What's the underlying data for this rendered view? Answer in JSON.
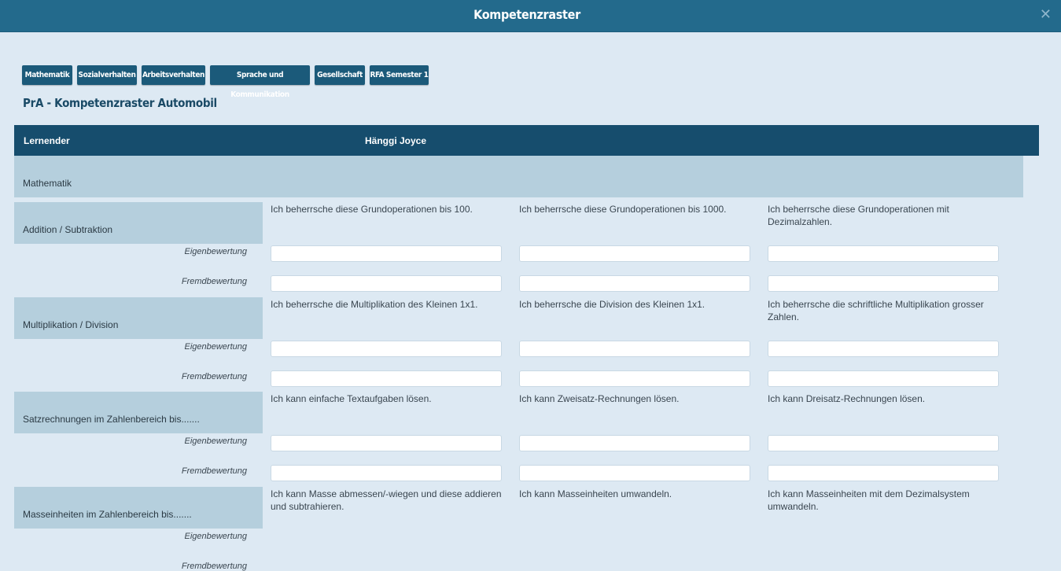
{
  "window": {
    "title": "Kompetenzraster",
    "close_icon": "close-icon"
  },
  "tabs": [
    "Mathematik",
    "Sozialverhalten",
    "Arbeitsverhalten",
    "Sprache und Kommunikation",
    "Gesellschaft",
    "RFA Semester 1"
  ],
  "page_title": "PrA - Kompetenzraster Automobil",
  "table": {
    "learner_label": "Lernender",
    "learner_name": "Hänggi Joyce",
    "section": "Mathematik",
    "rating_labels": {
      "self": "Eigenbewertung",
      "external": "Fremdbewertung"
    },
    "rows": [
      {
        "category": "Addition / Subtraktion",
        "criteria": [
          "Ich beherrsche diese Grundoperationen bis 100.",
          "Ich beherrsche diese Grundoperationen bis 1000.",
          "Ich beherrsche diese Grundoperationen mit Dezimalzahlen."
        ]
      },
      {
        "category": "Multiplikation / Division",
        "criteria": [
          "Ich beherrsche die Multiplikation des Kleinen 1x1.",
          "Ich beherrsche die Division des Kleinen 1x1.",
          "Ich beherrsche die schriftliche Multiplikation grosser Zahlen."
        ]
      },
      {
        "category": "Satzrechnungen im Zahlenbereich bis.......",
        "criteria": [
          "Ich kann einfache Textaufgaben lösen.",
          "Ich kann Zweisatz-Rechnungen lösen.",
          "Ich kann Dreisatz-Rechnungen lösen."
        ]
      },
      {
        "category": "Masseinheiten im Zahlenbereich bis.......",
        "criteria": [
          "Ich kann Masse abmessen/-wiegen und diese addieren und subtrahieren.",
          "Ich kann Masseinheiten umwandeln.",
          "Ich kann Masseinheiten mit dem Dezimalsystem umwandeln."
        ]
      }
    ]
  },
  "colors": {
    "titlebar": "#236a8c",
    "tab": "#1b5a7a",
    "header": "#164d6d",
    "category": "#b5cfdd",
    "background": "#dde9f3"
  }
}
